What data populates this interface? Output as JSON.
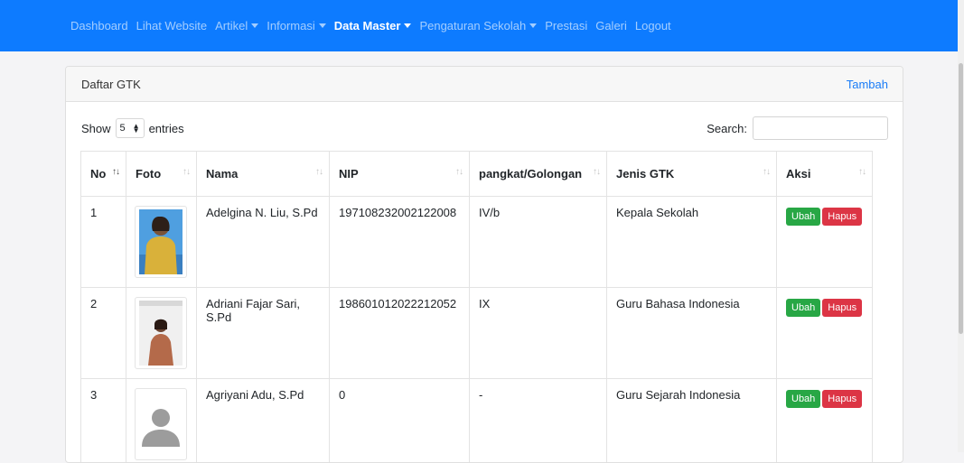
{
  "nav": {
    "items": [
      {
        "label": "Dashboard",
        "dropdown": false,
        "active": false
      },
      {
        "label": "Lihat Website",
        "dropdown": false,
        "active": false
      },
      {
        "label": "Artikel",
        "dropdown": true,
        "active": false
      },
      {
        "label": "Informasi",
        "dropdown": true,
        "active": false
      },
      {
        "label": "Data Master",
        "dropdown": true,
        "active": true
      },
      {
        "label": "Pengaturan Sekolah",
        "dropdown": true,
        "active": false
      },
      {
        "label": "Prestasi",
        "dropdown": false,
        "active": false
      },
      {
        "label": "Galeri",
        "dropdown": false,
        "active": false
      },
      {
        "label": "Logout",
        "dropdown": false,
        "active": false
      }
    ]
  },
  "card": {
    "title": "Daftar GTK",
    "add_label": "Tambah"
  },
  "controls": {
    "show_label": "Show",
    "entries_value": "5",
    "entries_label": "entries",
    "search_label": "Search:",
    "search_value": ""
  },
  "table": {
    "headers": [
      "No",
      "Foto",
      "Nama",
      "NIP",
      "pangkat/Golongan",
      "Jenis GTK",
      "Aksi"
    ],
    "rows": [
      {
        "no": "1",
        "photo": "person-photo-yellow",
        "nama": "Adelgina N. Liu, S.Pd",
        "nip": "197108232002122008",
        "pangkat": "IV/b",
        "jenis": "Kepala Sekolah"
      },
      {
        "no": "2",
        "photo": "person-photo-brown",
        "nama": "Adriani Fajar Sari, S.Pd",
        "nip": "198601012022212052",
        "pangkat": "IX",
        "jenis": "Guru Bahasa Indonesia"
      },
      {
        "no": "3",
        "photo": "avatar-placeholder",
        "nama": "Agriyani Adu, S.Pd",
        "nip": "0",
        "pangkat": "-",
        "jenis": "Guru Sejarah Indonesia"
      }
    ],
    "edit_label": "Ubah",
    "delete_label": "Hapus"
  },
  "colors": {
    "navbar": "#0d7bff",
    "link": "#1a7cf7",
    "edit": "#28a745",
    "delete": "#dc3545"
  }
}
